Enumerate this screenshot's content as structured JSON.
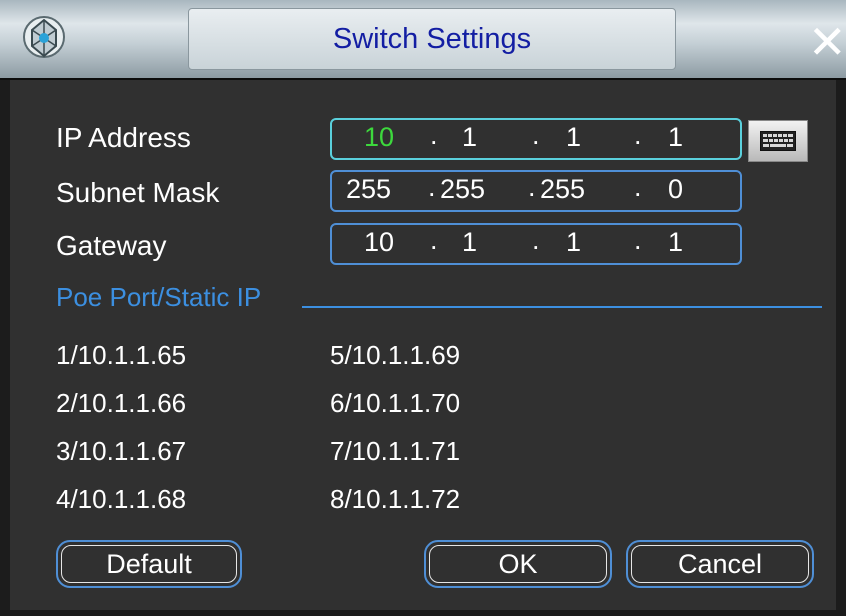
{
  "dialog": {
    "title": "Switch Settings"
  },
  "icons": {
    "app": "network-settings-icon",
    "close": "close-icon",
    "keyboard": "keyboard-icon"
  },
  "form": {
    "ip_address": {
      "label": "IP Address",
      "octets": [
        "10",
        "1",
        "1",
        "1"
      ]
    },
    "subnet_mask": {
      "label": "Subnet Mask",
      "octets": [
        "255",
        "255",
        "255",
        "0"
      ]
    },
    "gateway": {
      "label": "Gateway",
      "octets": [
        "10",
        "1",
        "1",
        "1"
      ]
    }
  },
  "poe": {
    "title": "Poe Port/Static IP",
    "ports": [
      "1/10.1.1.65",
      "2/10.1.1.66",
      "3/10.1.1.67",
      "4/10.1.1.68",
      "5/10.1.1.69",
      "6/10.1.1.70",
      "7/10.1.1.71",
      "8/10.1.1.72"
    ]
  },
  "buttons": {
    "default": "Default",
    "ok": "OK",
    "cancel": "Cancel"
  },
  "colors": {
    "accent_blue": "#4f8fd6",
    "focus_cyan": "#5ad0dc",
    "title_text": "#131ea3",
    "active_octet": "#3dd83d"
  }
}
